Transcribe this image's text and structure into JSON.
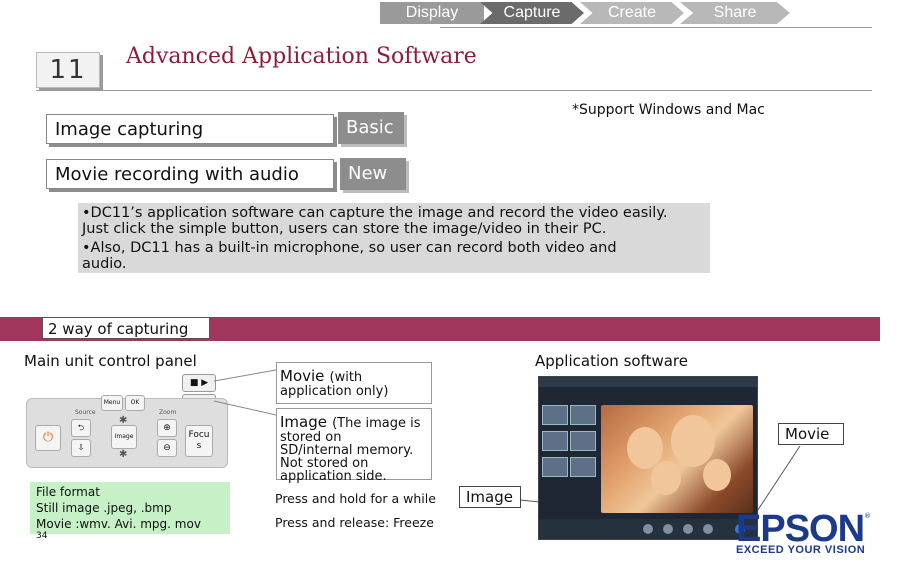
{
  "breadcrumb": {
    "items": [
      {
        "label": "Display"
      },
      {
        "label": "Capture"
      },
      {
        "label": "Create"
      },
      {
        "label": "Share"
      }
    ]
  },
  "header": {
    "model_number": "11",
    "title": "Advanced Application Software"
  },
  "support_note": "*Support Windows and Mac",
  "features": [
    {
      "name": "Image capturing",
      "tag": "Basic"
    },
    {
      "name": "Movie recording with audio",
      "tag": "New"
    }
  ],
  "description": {
    "line1": "•DC11’s application software can capture the image and record the video easily.",
    "line2": "Just click the simple button, users can store the image/video in their PC.",
    "line3": "•Also, DC11 has a built-in microphone, so user can record both video and",
    "line4": "audio."
  },
  "section": {
    "label": "2 way of capturing"
  },
  "control_panel": {
    "title": "Main unit control panel",
    "focus_label": "Focu",
    "focus_label2": "s",
    "source_label": "Source",
    "zoom_label": "Zoom",
    "menu_label": "Menu",
    "image_label": "Image"
  },
  "movie_note": {
    "title": "Movie",
    "suffix": "(with",
    "line2": "application only)"
  },
  "image_note": {
    "title": "Image",
    "suffix": "(The image is",
    "line2": "stored on",
    "line3": "SD/internal memory.",
    "line4": "Not stored on",
    "line5": "application side."
  },
  "press_hold": "Press and hold for a while",
  "press_release": "Press and release: Freeze",
  "file_format": {
    "line1": "File format",
    "line2": "Still image .jpeg, .bmp",
    "line3": "Movie :wmv. Avi. mpg. mov"
  },
  "page_number": "34",
  "app_software": {
    "title": "Application software",
    "callout_movie": "Movie",
    "callout_image": "Image"
  },
  "brand": {
    "logo": "EPSON",
    "tagline": "EXCEED YOUR VISION"
  },
  "colors": {
    "accent": "#a0365c",
    "title": "#8a1c3c",
    "brand": "#1c3a8a",
    "file_box": "#c6f0c6"
  }
}
